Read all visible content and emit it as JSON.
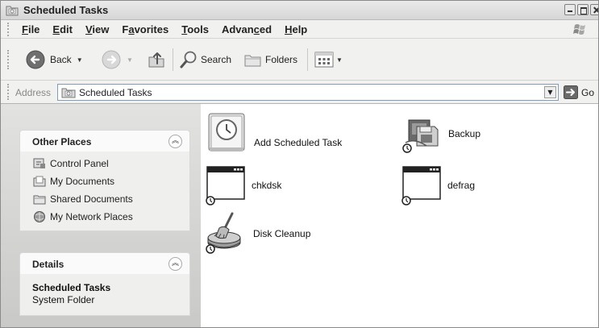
{
  "window": {
    "title": "Scheduled Tasks"
  },
  "menu": [
    {
      "label": "File",
      "mnemonic_index": 0
    },
    {
      "label": "Edit",
      "mnemonic_index": 0
    },
    {
      "label": "View",
      "mnemonic_index": 0
    },
    {
      "label": "Favorites",
      "mnemonic_index": 1
    },
    {
      "label": "Tools",
      "mnemonic_index": 0
    },
    {
      "label": "Advanced",
      "mnemonic_index": 5
    },
    {
      "label": "Help",
      "mnemonic_index": 0
    }
  ],
  "toolbar": {
    "back_label": "Back",
    "search_label": "Search",
    "folders_label": "Folders"
  },
  "address": {
    "label": "Address",
    "value": "Scheduled Tasks",
    "go_label": "Go"
  },
  "other_places": {
    "title": "Other Places",
    "items": [
      {
        "label": "Control Panel",
        "icon": "control-panel-icon"
      },
      {
        "label": "My Documents",
        "icon": "my-documents-icon"
      },
      {
        "label": "Shared Documents",
        "icon": "shared-documents-icon"
      },
      {
        "label": "My Network Places",
        "icon": "network-places-icon"
      }
    ]
  },
  "details": {
    "title": "Details",
    "name": "Scheduled Tasks",
    "type": "System Folder"
  },
  "items": [
    {
      "label": "Add Scheduled Task",
      "icon": "add-task-icon"
    },
    {
      "label": "Backup",
      "icon": "backup-icon"
    },
    {
      "label": "chkdsk",
      "icon": "program-window-icon"
    },
    {
      "label": "defrag",
      "icon": "program-window-icon"
    },
    {
      "label": "Disk Cleanup",
      "icon": "disk-cleanup-icon"
    }
  ]
}
